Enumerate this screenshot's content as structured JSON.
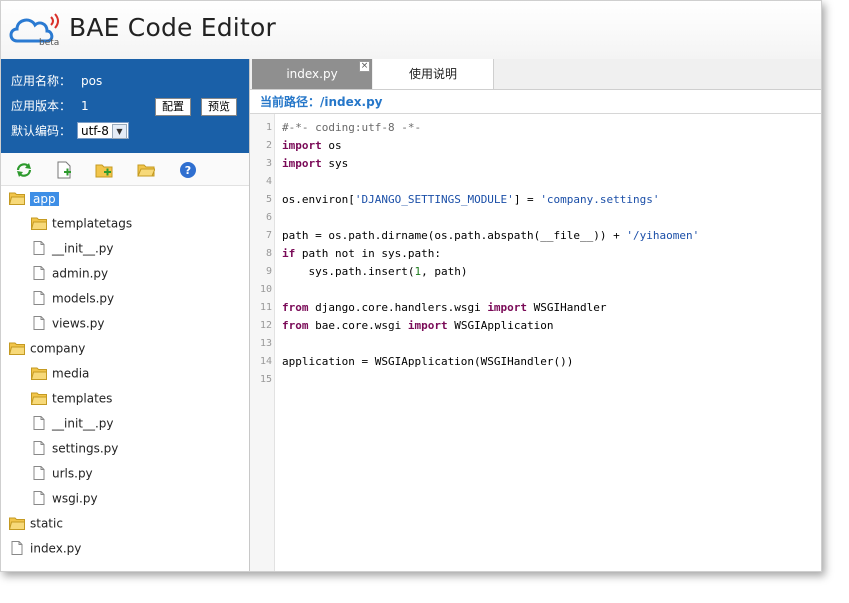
{
  "header": {
    "title": "BAE Code Editor",
    "beta": "beta"
  },
  "app_info": {
    "name_label": "应用名称：",
    "name_value": "pos",
    "version_label": "应用版本：",
    "version_value": "1",
    "config_button": "配置",
    "preview_button": "预览",
    "encoding_label": "默认编码：",
    "encoding_value": "utf-8"
  },
  "toolbar": {
    "icons": [
      "refresh-icon",
      "new-file-icon",
      "new-folder-icon",
      "open-folder-icon",
      "help-icon"
    ]
  },
  "tree": [
    {
      "name": "app",
      "type": "folder",
      "level": 0,
      "selected": true
    },
    {
      "name": "templatetags",
      "type": "folder",
      "level": 1
    },
    {
      "name": "__init__.py",
      "type": "file",
      "level": 1
    },
    {
      "name": "admin.py",
      "type": "file",
      "level": 1
    },
    {
      "name": "models.py",
      "type": "file",
      "level": 1
    },
    {
      "name": "views.py",
      "type": "file",
      "level": 1
    },
    {
      "name": "company",
      "type": "folder",
      "level": 0
    },
    {
      "name": "media",
      "type": "folder",
      "level": 1
    },
    {
      "name": "templates",
      "type": "folder",
      "level": 1
    },
    {
      "name": "__init__.py",
      "type": "file",
      "level": 1
    },
    {
      "name": "settings.py",
      "type": "file",
      "level": 1
    },
    {
      "name": "urls.py",
      "type": "file",
      "level": 1
    },
    {
      "name": "wsgi.py",
      "type": "file",
      "level": 1
    },
    {
      "name": "static",
      "type": "folder",
      "level": 0
    },
    {
      "name": "index.py",
      "type": "file",
      "level": 0
    }
  ],
  "tabs": {
    "active": "index.py",
    "other": "使用说明"
  },
  "current_path": {
    "label": "当前路径：",
    "value": "/index.py"
  },
  "code_lines": [
    [
      [
        "com",
        "#-*- coding:utf-8 -*-"
      ]
    ],
    [
      [
        "kw",
        "import"
      ],
      [
        "",
        " os"
      ]
    ],
    [
      [
        "kw",
        "import"
      ],
      [
        "",
        " sys"
      ]
    ],
    [],
    [
      [
        "",
        "os.environ["
      ],
      [
        "str",
        "'DJANGO_SETTINGS_MODULE'"
      ],
      [
        "",
        "] = "
      ],
      [
        "str",
        "'company.settings'"
      ]
    ],
    [],
    [
      [
        "",
        "path = os.path.dirname(os.path.abspath(__file__)) + "
      ],
      [
        "str",
        "'/yihaomen'"
      ]
    ],
    [
      [
        "kw",
        "if"
      ],
      [
        "",
        " path not in sys.path:"
      ]
    ],
    [
      [
        "",
        "    sys.path.insert("
      ],
      [
        "num",
        "1"
      ],
      [
        "",
        ", path)"
      ]
    ],
    [],
    [
      [
        "kw",
        "from"
      ],
      [
        "",
        " django.core.handlers.wsgi "
      ],
      [
        "kw",
        "import"
      ],
      [
        "",
        " WSGIHandler"
      ]
    ],
    [
      [
        "kw",
        "from"
      ],
      [
        "",
        " bae.core.wsgi "
      ],
      [
        "kw",
        "import"
      ],
      [
        "",
        " WSGIApplication"
      ]
    ],
    [],
    [
      [
        "",
        "application = WSGIApplication(WSGIHandler())"
      ]
    ],
    []
  ],
  "line_numbers": [
    "1",
    "2",
    "3",
    "4",
    "5",
    "6",
    "7",
    "8",
    "9",
    "10",
    "11",
    "12",
    "13",
    "14",
    "15"
  ]
}
